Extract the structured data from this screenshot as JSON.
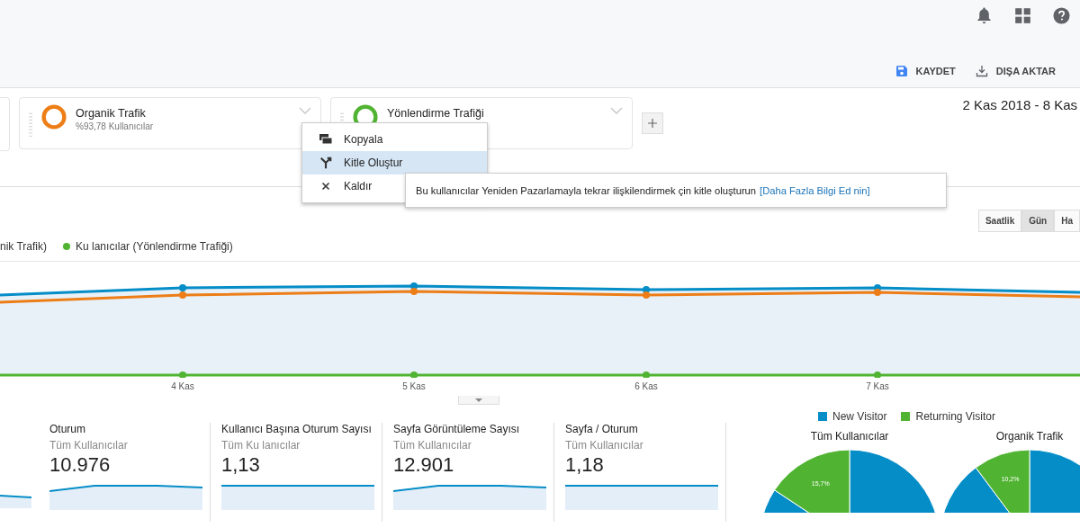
{
  "toolbar": {
    "actions": [
      {
        "kind": "save",
        "label": "KAYDET"
      },
      {
        "kind": "export",
        "label": "DIŞA AKTAR"
      }
    ]
  },
  "segments": [
    {
      "title": "Organik Trafik",
      "subtitle": "%93,78 Kullanıcılar",
      "color": "#ed7e17"
    },
    {
      "title": "Yönlendirme Trafiği",
      "color": "#50b432"
    }
  ],
  "date_range": "2 Kas 2018 - 8 Kas",
  "segment_menu": {
    "items": [
      {
        "kind": "copy",
        "label": "Kopyala",
        "selected": false
      },
      {
        "kind": "audience",
        "label": "Kitle Oluştur",
        "selected": true
      },
      {
        "kind": "remove",
        "label": "Kaldır",
        "selected": false
      }
    ]
  },
  "tooltip": {
    "text": "Bu kullanıcılar  Yeniden Pazarlamayla tekrar ilişkilendirmek  çin kitle oluşturun",
    "link": "[Daha Fazla Bilgi Ed nin]"
  },
  "granularity": [
    {
      "label": "Saatlik",
      "selected": false
    },
    {
      "label": "Gün",
      "selected": true
    },
    {
      "label": "Ha",
      "selected": false
    }
  ],
  "chart": {
    "cut_legend_text": "nik Trafik)",
    "legend": [
      {
        "label": "Ku lanıcılar (Yönlendirme Trafiği)",
        "color": "#50b432"
      }
    ],
    "x_labels": [
      "4 Kas",
      "5 Kas",
      "6 Kas",
      "7 Kas"
    ]
  },
  "metrics": [
    {
      "title": "Oturum",
      "subtitle": "Tüm Kullanıcılar",
      "value": "10.976"
    },
    {
      "title": "Kullanıcı Başına Oturum Sayısı",
      "subtitle": "Tüm Ku lanıcılar",
      "value": "1,13"
    },
    {
      "title": "Sayfa Görüntüleme Sayısı",
      "subtitle": "Tüm Kullanıcılar",
      "value": "12.901"
    },
    {
      "title": "Sayfa / Oturum",
      "subtitle": "Tüm Kullanıcılar",
      "value": "1,18"
    }
  ],
  "pie_legend": [
    {
      "label": "New Visitor",
      "color": "#058dc7"
    },
    {
      "label": "Returning Visitor",
      "color": "#50b432"
    }
  ],
  "pies": [
    {
      "chart_data": {
        "type": "pie",
        "title": "Tüm Kullanıcılar",
        "values": [
          84.3,
          15.7
        ],
        "value_labels": [
          null,
          "15,7%"
        ]
      }
    },
    {
      "chart_data": {
        "type": "pie",
        "title": "Organik Trafik",
        "values": [
          89.8,
          10.2
        ],
        "value_labels": [
          null,
          "10,2%"
        ]
      }
    }
  ]
}
